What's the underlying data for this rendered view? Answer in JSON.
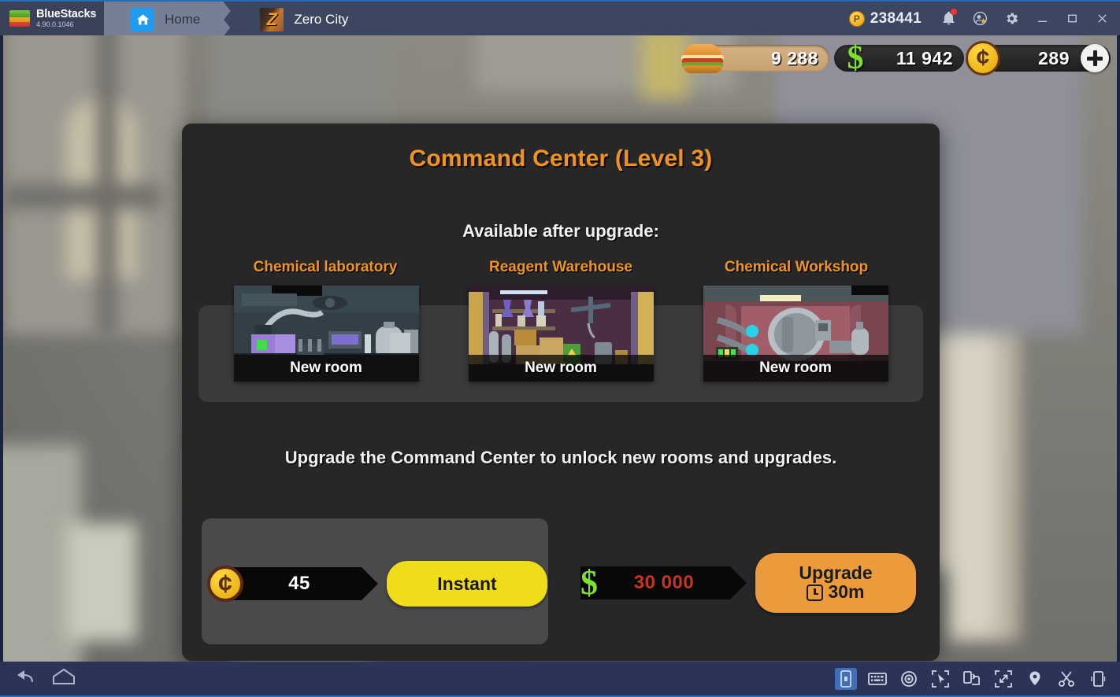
{
  "titlebar": {
    "brand_name": "BlueStacks",
    "brand_version": "4.90.0.1046",
    "tabs": [
      {
        "label": "Home",
        "icon": "home-icon",
        "active": false
      },
      {
        "label": "Zero City",
        "icon": "zero-city-app-icon",
        "active": true
      }
    ],
    "points_icon": "points-coin-icon",
    "points_value": "238441",
    "icons": {
      "notifications": "bell-icon",
      "account": "account-star-icon",
      "settings": "gear-icon",
      "minimize": "minimize-icon",
      "maximize": "maximize-icon",
      "close": "close-icon"
    }
  },
  "hud": {
    "food": {
      "icon": "burger-icon",
      "value": "9 288"
    },
    "money": {
      "icon": "dollar-icon",
      "value": "11 942"
    },
    "gold": {
      "icon": "gold-coin-icon",
      "value": "289",
      "add_button": "plus-icon"
    }
  },
  "dialog": {
    "title": "Command Center (Level 3)",
    "subtitle": "Available after upgrade:",
    "rooms": [
      {
        "title": "Chemical laboratory",
        "badge": "New room"
      },
      {
        "title": "Reagent Warehouse",
        "badge": "New room"
      },
      {
        "title": "Chemical Workshop",
        "badge": "New room"
      }
    ],
    "description": "Upgrade the Command Center to unlock new rooms and upgrades.",
    "actions": {
      "instant": {
        "currency_icon": "gold-coin-icon",
        "price": "45",
        "button_label": "Instant"
      },
      "upgrade": {
        "currency_icon": "dollar-icon",
        "price": "30 000",
        "button_label": "Upgrade",
        "timer_icon": "clock-icon",
        "timer": "30m"
      }
    }
  },
  "bottombar": {
    "nav": [
      {
        "name": "back-icon"
      },
      {
        "name": "home-icon"
      }
    ],
    "tools": [
      {
        "name": "lock-orientation-icon",
        "selected": true
      },
      {
        "name": "keyboard-icon",
        "selected": false
      },
      {
        "name": "eye-icon",
        "selected": false
      },
      {
        "name": "pointer-icon",
        "selected": false
      },
      {
        "name": "rotate-screen-icon",
        "selected": false
      },
      {
        "name": "fullscreen-icon",
        "selected": false
      },
      {
        "name": "location-pin-icon",
        "selected": false
      },
      {
        "name": "scissors-icon",
        "selected": false
      },
      {
        "name": "shake-device-icon",
        "selected": false
      }
    ]
  },
  "colors": {
    "accent_orange": "#f09321",
    "instant_yellow": "#efdc1a",
    "upgrade_orange": "#eb9a3c",
    "money_green": "#7ee02a",
    "price_red": "#c8341e",
    "dialog_bg": "#272727",
    "titlebar_bg": "#3d4661",
    "bottombar_bg": "#2b3356"
  }
}
